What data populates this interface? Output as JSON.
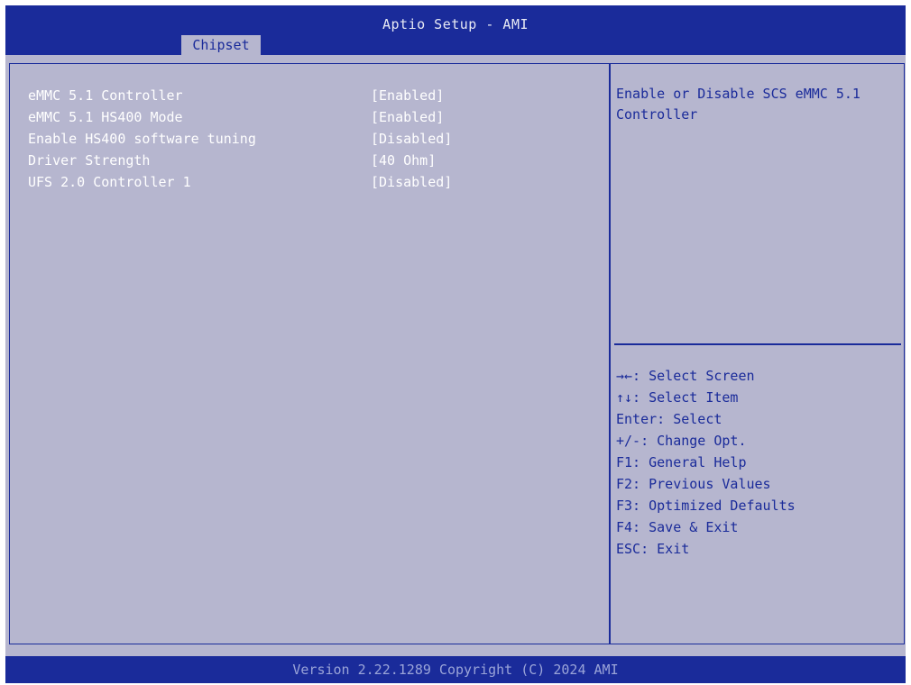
{
  "header": {
    "title": "Aptio Setup - AMI",
    "active_tab": "Chipset"
  },
  "settings": [
    {
      "label": "eMMC 5.1 Controller",
      "value": "[Enabled]"
    },
    {
      "label": "eMMC 5.1 HS400 Mode",
      "value": "[Enabled]"
    },
    {
      "label": "Enable HS400 software tuning",
      "value": "[Disabled]"
    },
    {
      "label": "Driver Strength",
      "value": "[40 Ohm]"
    },
    {
      "label": "UFS 2.0 Controller 1",
      "value": "[Disabled]"
    }
  ],
  "help": {
    "description": "Enable or Disable SCS eMMC 5.1 Controller"
  },
  "keys": [
    "→←: Select Screen",
    "↑↓: Select Item",
    "Enter: Select",
    "+/-: Change Opt.",
    "F1: General Help",
    "F2: Previous Values",
    "F3: Optimized Defaults",
    "F4: Save & Exit",
    "ESC: Exit"
  ],
  "footer": {
    "version": "Version 2.22.1289 Copyright (C) 2024 AMI"
  },
  "colors": {
    "header_blue": "#1a2b9a",
    "panel_gray": "#b6b6cf",
    "text_white": "#ffffff",
    "text_blue": "#1a2b9a"
  }
}
